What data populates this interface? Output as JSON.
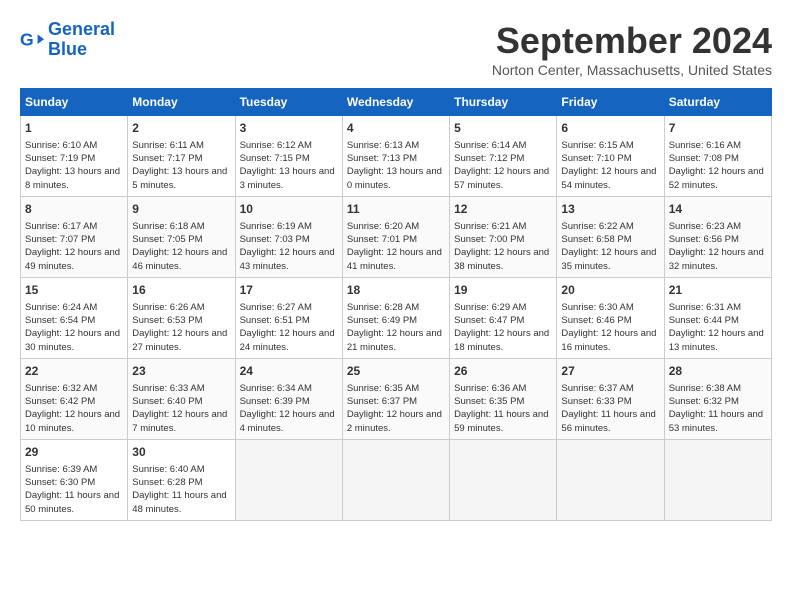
{
  "logo": {
    "line1": "General",
    "line2": "Blue"
  },
  "title": "September 2024",
  "location": "Norton Center, Massachusetts, United States",
  "days_header": [
    "Sunday",
    "Monday",
    "Tuesday",
    "Wednesday",
    "Thursday",
    "Friday",
    "Saturday"
  ],
  "weeks": [
    [
      {
        "day": "1",
        "sunrise": "6:10 AM",
        "sunset": "7:19 PM",
        "daylight": "13 hours and 8 minutes."
      },
      {
        "day": "2",
        "sunrise": "6:11 AM",
        "sunset": "7:17 PM",
        "daylight": "13 hours and 5 minutes."
      },
      {
        "day": "3",
        "sunrise": "6:12 AM",
        "sunset": "7:15 PM",
        "daylight": "13 hours and 3 minutes."
      },
      {
        "day": "4",
        "sunrise": "6:13 AM",
        "sunset": "7:13 PM",
        "daylight": "13 hours and 0 minutes."
      },
      {
        "day": "5",
        "sunrise": "6:14 AM",
        "sunset": "7:12 PM",
        "daylight": "12 hours and 57 minutes."
      },
      {
        "day": "6",
        "sunrise": "6:15 AM",
        "sunset": "7:10 PM",
        "daylight": "12 hours and 54 minutes."
      },
      {
        "day": "7",
        "sunrise": "6:16 AM",
        "sunset": "7:08 PM",
        "daylight": "12 hours and 52 minutes."
      }
    ],
    [
      {
        "day": "8",
        "sunrise": "6:17 AM",
        "sunset": "7:07 PM",
        "daylight": "12 hours and 49 minutes."
      },
      {
        "day": "9",
        "sunrise": "6:18 AM",
        "sunset": "7:05 PM",
        "daylight": "12 hours and 46 minutes."
      },
      {
        "day": "10",
        "sunrise": "6:19 AM",
        "sunset": "7:03 PM",
        "daylight": "12 hours and 43 minutes."
      },
      {
        "day": "11",
        "sunrise": "6:20 AM",
        "sunset": "7:01 PM",
        "daylight": "12 hours and 41 minutes."
      },
      {
        "day": "12",
        "sunrise": "6:21 AM",
        "sunset": "7:00 PM",
        "daylight": "12 hours and 38 minutes."
      },
      {
        "day": "13",
        "sunrise": "6:22 AM",
        "sunset": "6:58 PM",
        "daylight": "12 hours and 35 minutes."
      },
      {
        "day": "14",
        "sunrise": "6:23 AM",
        "sunset": "6:56 PM",
        "daylight": "12 hours and 32 minutes."
      }
    ],
    [
      {
        "day": "15",
        "sunrise": "6:24 AM",
        "sunset": "6:54 PM",
        "daylight": "12 hours and 30 minutes."
      },
      {
        "day": "16",
        "sunrise": "6:26 AM",
        "sunset": "6:53 PM",
        "daylight": "12 hours and 27 minutes."
      },
      {
        "day": "17",
        "sunrise": "6:27 AM",
        "sunset": "6:51 PM",
        "daylight": "12 hours and 24 minutes."
      },
      {
        "day": "18",
        "sunrise": "6:28 AM",
        "sunset": "6:49 PM",
        "daylight": "12 hours and 21 minutes."
      },
      {
        "day": "19",
        "sunrise": "6:29 AM",
        "sunset": "6:47 PM",
        "daylight": "12 hours and 18 minutes."
      },
      {
        "day": "20",
        "sunrise": "6:30 AM",
        "sunset": "6:46 PM",
        "daylight": "12 hours and 16 minutes."
      },
      {
        "day": "21",
        "sunrise": "6:31 AM",
        "sunset": "6:44 PM",
        "daylight": "12 hours and 13 minutes."
      }
    ],
    [
      {
        "day": "22",
        "sunrise": "6:32 AM",
        "sunset": "6:42 PM",
        "daylight": "12 hours and 10 minutes."
      },
      {
        "day": "23",
        "sunrise": "6:33 AM",
        "sunset": "6:40 PM",
        "daylight": "12 hours and 7 minutes."
      },
      {
        "day": "24",
        "sunrise": "6:34 AM",
        "sunset": "6:39 PM",
        "daylight": "12 hours and 4 minutes."
      },
      {
        "day": "25",
        "sunrise": "6:35 AM",
        "sunset": "6:37 PM",
        "daylight": "12 hours and 2 minutes."
      },
      {
        "day": "26",
        "sunrise": "6:36 AM",
        "sunset": "6:35 PM",
        "daylight": "11 hours and 59 minutes."
      },
      {
        "day": "27",
        "sunrise": "6:37 AM",
        "sunset": "6:33 PM",
        "daylight": "11 hours and 56 minutes."
      },
      {
        "day": "28",
        "sunrise": "6:38 AM",
        "sunset": "6:32 PM",
        "daylight": "11 hours and 53 minutes."
      }
    ],
    [
      {
        "day": "29",
        "sunrise": "6:39 AM",
        "sunset": "6:30 PM",
        "daylight": "11 hours and 50 minutes."
      },
      {
        "day": "30",
        "sunrise": "6:40 AM",
        "sunset": "6:28 PM",
        "daylight": "11 hours and 48 minutes."
      },
      null,
      null,
      null,
      null,
      null
    ]
  ]
}
